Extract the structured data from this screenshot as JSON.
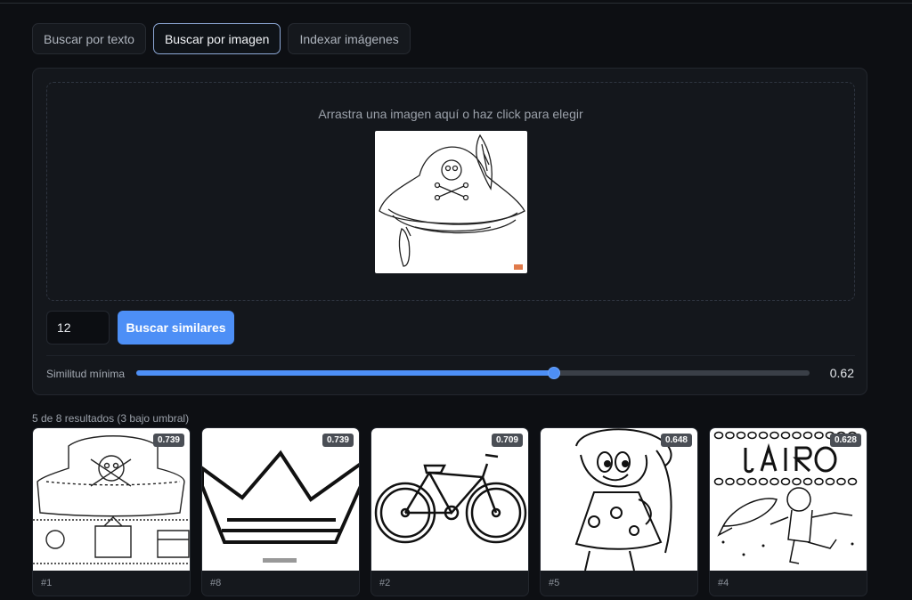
{
  "tabs": [
    {
      "label": "Buscar por texto",
      "active": false
    },
    {
      "label": "Buscar por imagen",
      "active": true
    },
    {
      "label": "Indexar imágenes",
      "active": false
    }
  ],
  "dropzone": {
    "text": "Arrastra una imagen aquí o haz click para elegir",
    "preview_icon": "pirate-hat-image"
  },
  "controls": {
    "count_value": "12",
    "search_button": "Buscar similares",
    "similarity_label": "Similitud mínima",
    "similarity_value": "0.62",
    "similarity_level": 0.62
  },
  "results": {
    "summary": "5 de 8 resultados (3 bajo umbral)",
    "items": [
      {
        "score": "0.739",
        "rank": "#1",
        "image": "pirate-hat-crown-coloring"
      },
      {
        "score": "0.739",
        "rank": "#8",
        "image": "crown-coloring"
      },
      {
        "score": "0.709",
        "rank": "#2",
        "image": "bicycle-coloring"
      },
      {
        "score": "0.648",
        "rank": "#5",
        "image": "smurfette-coloring"
      },
      {
        "score": "0.628",
        "rank": "#4",
        "image": "astronaut-jairo-coloring"
      }
    ]
  },
  "colors": {
    "accent": "#4d8ff6",
    "background": "#0d0f13",
    "panel": "#14171c"
  }
}
